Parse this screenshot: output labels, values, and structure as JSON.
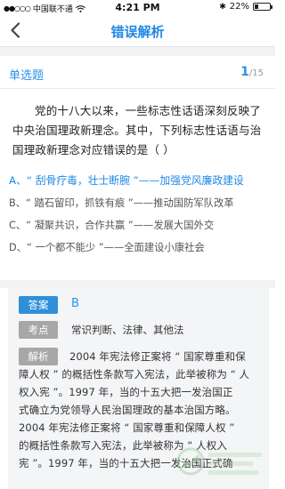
{
  "status_bar": {
    "carrier": "中国联不通",
    "time": "4:21 PM",
    "battery_percent": "22%",
    "battery_level": 0.22
  },
  "nav": {
    "title": "错误解析"
  },
  "question": {
    "type": "单选题",
    "current": "1",
    "total": "/15",
    "stem": "党的十八大以来，一些标志性话语深刻反映了中央治国理政新理念。其中，下列标志性话语与治国理政新理念对应错误的是（  ）",
    "options": [
      "A、“ 刮骨疗毒，壮士断腕 ”——加强党风廉政建设",
      "B、“ 踏石留印，抓铁有痕 ”——推动国防军队改革",
      "C、“ 凝聚共识，合作共赢 ”——发展大国外交",
      "D、“ 一个都不能少 ”——全面建设小康社会"
    ]
  },
  "answer": {
    "label": "答案",
    "value": "B"
  },
  "knowledge": {
    "label": "考点",
    "value": "常识判断、法律、其他法"
  },
  "analysis": {
    "label": "解析",
    "first_line": "2004 年宪法修正案将 “ 国家尊重和保",
    "lines": [
      "障人权 ” 的概括性条款写入宪法，此举被称为 “ 人",
      "权入宪 ”。1997 年，当的十五大把一发治国正",
      "式确立为党领导人民治国理政的基本治国方略。",
      "2004 年宪法修正案将 “ 国家尊重和保障人权 ”",
      "的概括性条款写入宪法，此举被称为 “ 人权入",
      "宪 ”。1997 年，当的十五大把一发治国正式确"
    ]
  },
  "colors": {
    "accent": "#1e88e5",
    "tag_blue": "#2f8fd8",
    "tag_gray": "#a7a7a7"
  }
}
